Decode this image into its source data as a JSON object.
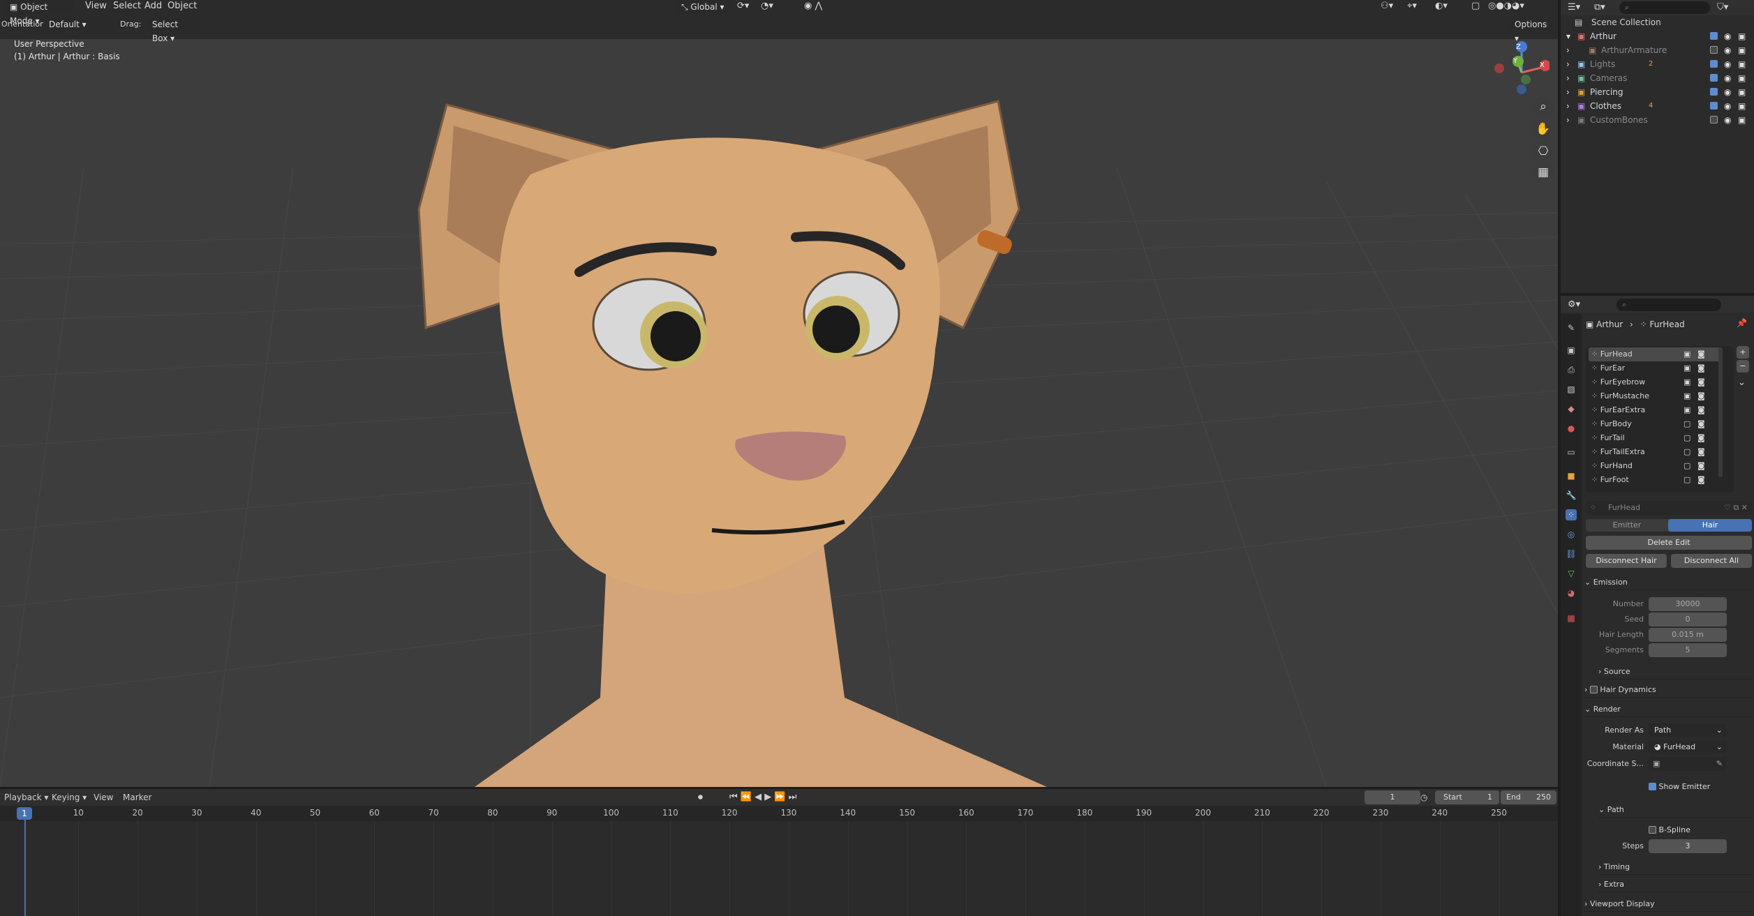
{
  "header": {
    "mode": "Object Mode",
    "menu": [
      "View",
      "Select",
      "Add",
      "Object"
    ],
    "orientation_label": "Orientation:",
    "orientation_value": "Default",
    "drag_label": "Drag:",
    "drag_value": "Select Box",
    "transform_orientation": "Global",
    "options_label": "Options"
  },
  "viewport": {
    "perspective": "User Perspective",
    "object_info": "(1) Arthur | Arthur : Basis",
    "gizmo": {
      "x": "X",
      "y": "Y",
      "z": "Z"
    }
  },
  "outliner": {
    "collection": "Scene Collection",
    "items": [
      {
        "name": "Arthur",
        "checked": true,
        "color": "#e0766a"
      },
      {
        "name": "ArthurArmature",
        "checked": false,
        "color": "#9a7a6a"
      },
      {
        "name": "Lights",
        "checked": true,
        "color": "#9cc4e4",
        "badge": "2"
      },
      {
        "name": "Cameras",
        "checked": true,
        "color": "#74c0a6"
      },
      {
        "name": "Piercing",
        "checked": true,
        "color": "#e0a040"
      },
      {
        "name": "Clothes",
        "checked": true,
        "color": "#b080e0",
        "badge": "4"
      },
      {
        "name": "CustomBones",
        "checked": false,
        "color": "#7a7a7a"
      }
    ]
  },
  "properties": {
    "breadcrumb": [
      "Arthur",
      "FurHead"
    ],
    "particle_slots": [
      "FurHead",
      "FurEar",
      "FurEyebrow",
      "FurMustache",
      "FurEarExtra",
      "FurBody",
      "FurTail",
      "FurTailExtra",
      "FurHand",
      "FurFoot"
    ],
    "settings_name": "FurHead",
    "type_tabs": [
      "Emitter",
      "Hair"
    ],
    "delete_edit": "Delete Edit",
    "disconnect_hair": "Disconnect Hair",
    "disconnect_all": "Disconnect All",
    "emission": {
      "title": "Emission",
      "number_label": "Number",
      "number": "30000",
      "seed_label": "Seed",
      "seed": "0",
      "hair_length_label": "Hair Length",
      "hair_length": "0.015 m",
      "segments_label": "Segments",
      "segments": "5"
    },
    "source": "Source",
    "hair_dynamics": "Hair Dynamics",
    "render": {
      "title": "Render",
      "render_as_label": "Render As",
      "render_as": "Path",
      "material_label": "Material",
      "material": "FurHead",
      "coord_label": "Coordinate S...",
      "show_emitter": "Show Emitter",
      "path": "Path",
      "bspline": "B-Spline",
      "steps_label": "Steps",
      "steps": "3"
    },
    "timing": "Timing",
    "extra": "Extra",
    "viewport_display": "Viewport Display"
  },
  "timeline": {
    "menu": [
      "Playback",
      "Keying",
      "View",
      "Marker"
    ],
    "current_frame": "1",
    "start_label": "Start",
    "start": "1",
    "end_label": "End",
    "end": "250",
    "ticks": [
      "10",
      "20",
      "30",
      "40",
      "50",
      "60",
      "70",
      "80",
      "90",
      "100",
      "110",
      "120",
      "130",
      "140",
      "150",
      "160",
      "170",
      "180",
      "190",
      "200",
      "210",
      "220",
      "230",
      "240",
      "250"
    ],
    "playhead": "1"
  },
  "colors": {
    "accent": "#4772b3",
    "viewport_bg": "#3d3d3d",
    "fur": "#d9a877"
  }
}
